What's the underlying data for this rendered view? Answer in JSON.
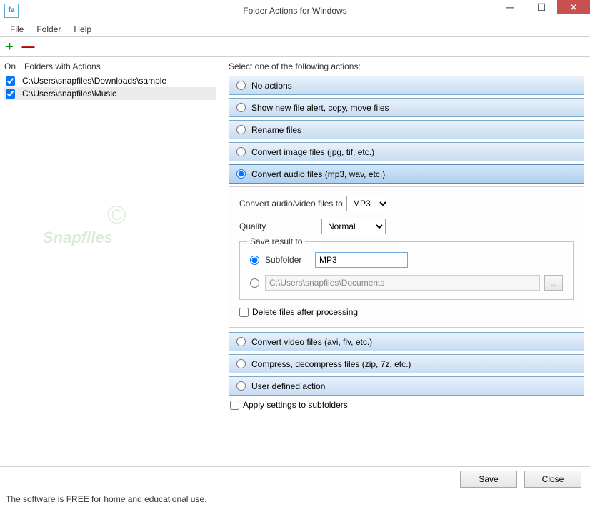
{
  "window": {
    "title": "Folder Actions for Windows",
    "icon_text": "fa"
  },
  "menu": {
    "file": "File",
    "folder": "Folder",
    "help": "Help"
  },
  "toolbar": {
    "add": "+",
    "remove": "—"
  },
  "left": {
    "col_on": "On",
    "col_folders": "Folders with Actions",
    "rows": [
      {
        "path": "C:\\Users\\snapfiles\\Downloads\\sample"
      },
      {
        "path": "C:\\Users\\snapfiles\\Music"
      }
    ]
  },
  "right": {
    "header": "Select one of the following actions:",
    "actions": {
      "none": "No actions",
      "alert": "Show new file alert, copy, move files",
      "rename": "Rename files",
      "convert_image": "Convert image files (jpg, tif, etc.)",
      "convert_audio": "Convert audio files (mp3, wav, etc.)",
      "convert_video": "Convert video files (avi, flv, etc.)",
      "compress": "Compress, decompress files (zip, 7z, etc.)",
      "user": "User defined action"
    },
    "detail": {
      "convert_to_label": "Convert audio/video files to",
      "format": "MP3",
      "quality_label": "Quality",
      "quality": "Normal",
      "fieldset_legend": "Save result to",
      "subfolder_label": "Subfolder",
      "subfolder_value": "MP3",
      "path_value": "C:\\Users\\snapfiles\\Documents",
      "browse": "...",
      "delete_after": "Delete files after processing"
    },
    "apply_subfolders": "Apply settings to subfolders"
  },
  "buttons": {
    "save": "Save",
    "close": "Close"
  },
  "status": "The software is FREE for home and educational use.",
  "watermark": "Snapfiles"
}
